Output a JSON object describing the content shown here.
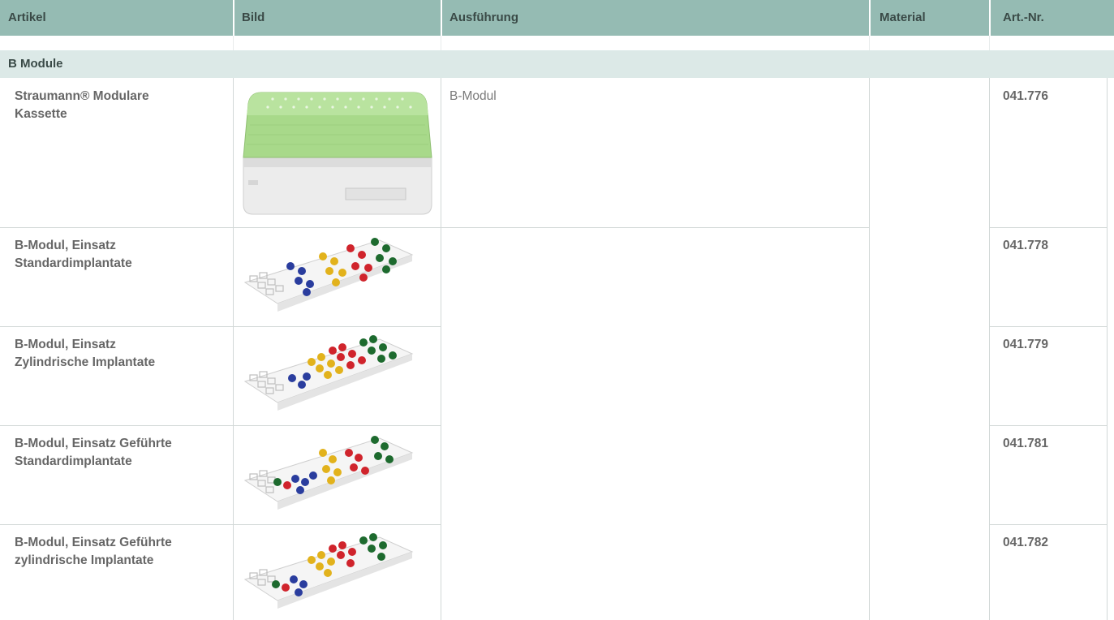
{
  "table": {
    "headers": [
      "Artikel",
      "Bild",
      "Ausführung",
      "Material",
      "Art.-Nr."
    ],
    "section_title": "B Module",
    "rows": [
      {
        "artikel_line1": "Straumann® Modulare",
        "artikel_line2": "Kassette",
        "ausfuehrung": "B-Modul",
        "art_nr": "041.776",
        "image": "green-lid-cassette"
      },
      {
        "artikel_line1": "B-Modul, Einsatz",
        "artikel_line2": "Standardimplantate",
        "ausfuehrung": "",
        "art_nr": "041.778",
        "image": "insert-tray-standard"
      },
      {
        "artikel_line1": "B-Modul, Einsatz",
        "artikel_line2": "Zylindrische Implantate",
        "ausfuehrung": "",
        "art_nr": "041.779",
        "image": "insert-tray-cylindrical"
      },
      {
        "artikel_line1": "B-Modul, Einsatz Geführte",
        "artikel_line2": "Standardimplantate",
        "ausfuehrung": "",
        "art_nr": "041.781",
        "image": "insert-tray-guided-standard"
      },
      {
        "artikel_line1": "B-Modul, Einsatz Geführte",
        "artikel_line2": "zylindrische Implantate",
        "ausfuehrung": "",
        "art_nr": "041.782",
        "image": "insert-tray-guided-cylindrical"
      }
    ]
  },
  "colors": {
    "header_bg": "#95bbb3",
    "section_bg": "#dce9e7",
    "dot_blue": "#2a3d9e",
    "dot_yellow": "#e2b21c",
    "dot_red": "#d0242c",
    "dot_green": "#1d6a2e",
    "lid_green": "#9fd37d"
  }
}
